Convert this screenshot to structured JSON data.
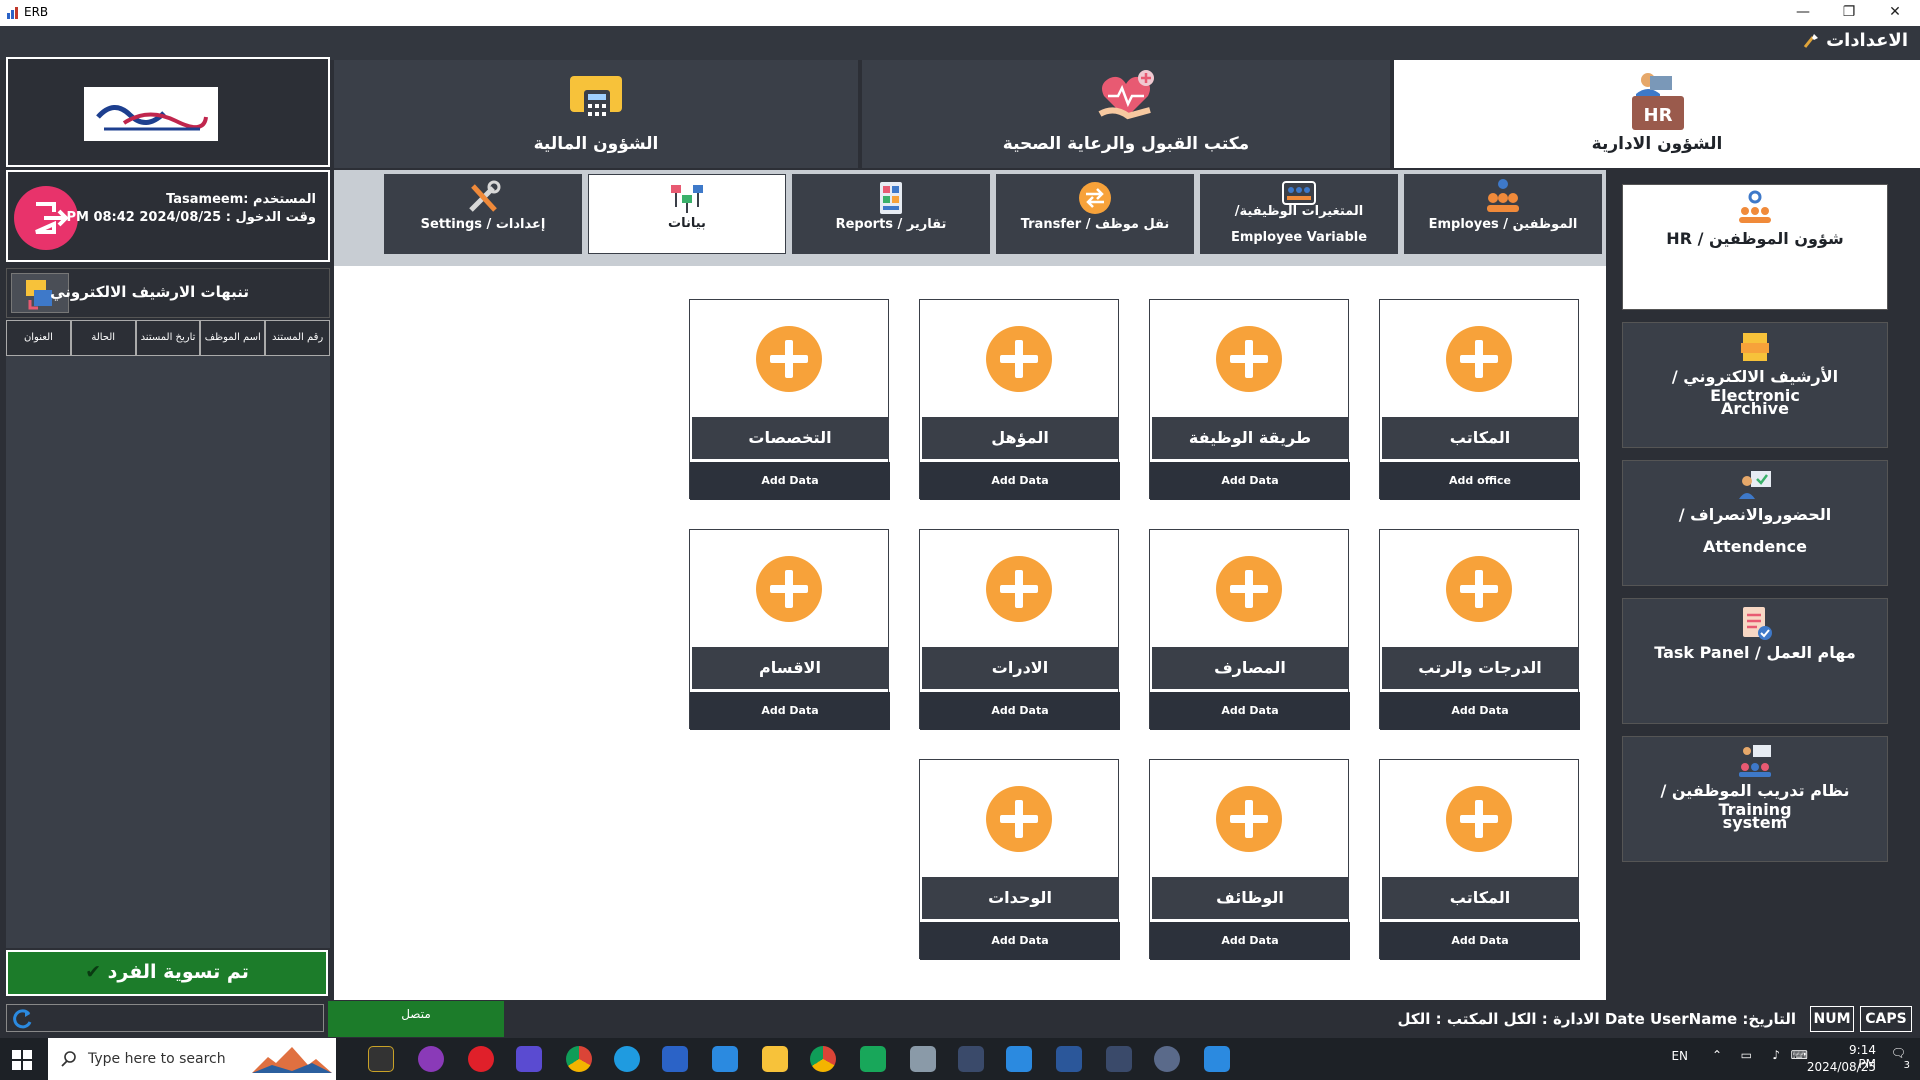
{
  "window": {
    "title": "ERB",
    "controls": [
      "—",
      "❐",
      "✕"
    ]
  },
  "menubar": {
    "settings_label": "الاعدادات"
  },
  "modules": [
    {
      "label": "الشؤون الادارية",
      "icon": "hr-icon",
      "active": true
    },
    {
      "label": "مكتب القبول والرعاية الصحية",
      "icon": "healthcare-icon",
      "active": false
    },
    {
      "label": "الشؤون المالية",
      "icon": "finance-icon",
      "active": false
    }
  ],
  "user": {
    "line1": "المستخدم :Tasameem",
    "line2": "وقت الدخول : PM 08:42 2024/08/25"
  },
  "subtabs": [
    {
      "label": "الموظفين / Employes",
      "label2": "",
      "icon": "employees-icon",
      "active": false
    },
    {
      "label": "المتغيرات الوظيفية/",
      "label2": "Employee Variable",
      "icon": "variables-icon",
      "active": false
    },
    {
      "label": "نقل موظف / Transfer",
      "label2": "",
      "icon": "transfer-icon",
      "active": false
    },
    {
      "label": "تقارير / Reports",
      "label2": "",
      "icon": "reports-icon",
      "active": false
    },
    {
      "label": "بيانات",
      "label2": "",
      "icon": "data-icon",
      "active": true
    },
    {
      "label": "إعدادات / Settings",
      "label2": "",
      "icon": "settings-tools-icon",
      "active": false
    }
  ],
  "archive": {
    "title": "تنبهات الارشيف الالكتروني",
    "columns": [
      "رقم المستند",
      "اسم الموظف",
      "تاريخ المستند",
      "الحالة",
      "العنوان"
    ]
  },
  "settle_button": "تم تسوية الفرد",
  "cards": [
    {
      "title": "المكاتب",
      "sub": "Add office"
    },
    {
      "title": "طريقة الوظيفة",
      "sub": "Add Data"
    },
    {
      "title": "المؤهل",
      "sub": "Add Data"
    },
    {
      "title": "التخصصات",
      "sub": "Add Data"
    },
    {
      "title": "الدرجات والرتب",
      "sub": "Add Data"
    },
    {
      "title": "المصارف",
      "sub": "Add Data"
    },
    {
      "title": "الادرات",
      "sub": "Add Data"
    },
    {
      "title": "الاقسام",
      "sub": "Add Data"
    },
    {
      "title": "المكاتب",
      "sub": "Add Data"
    },
    {
      "title": "الوظائف",
      "sub": "Add Data"
    },
    {
      "title": "الوحدات",
      "sub": "Add Data"
    }
  ],
  "rightnav": [
    {
      "l1": "شؤون الموظفين / HR",
      "l2": "",
      "icon": "hr-gear-icon",
      "active": true
    },
    {
      "l1": "الأرشيف الالكتروني / Electronic",
      "l2": "Archive",
      "icon": "archive-folder-icon",
      "active": false
    },
    {
      "l1": "الحضوروالانصراف /",
      "l2": "Attendence",
      "icon": "attendance-icon",
      "active": false
    },
    {
      "l1": "مهام العمل / Task Panel",
      "l2": "",
      "icon": "task-icon",
      "active": false
    },
    {
      "l1": "نظام تدريب الموظفين / Training",
      "l2": "system",
      "icon": "training-icon",
      "active": false
    }
  ],
  "status": {
    "online": "متصل",
    "text": "التاريخ: Date  UserName  الادارة : الكل المكتب : الكل",
    "num": "NUM",
    "caps": "CAPS"
  },
  "taskbar": {
    "search_placeholder": "Type here to search",
    "lang": "EN",
    "time": "9:14 PM",
    "date": "2024/08/25",
    "notif_count": "3"
  },
  "colors": {
    "accent_orange": "#f7a23a",
    "dark": "#2c2f36",
    "panel": "#3a3f48",
    "green": "#1c7c2a",
    "logout": "#e8336b"
  }
}
